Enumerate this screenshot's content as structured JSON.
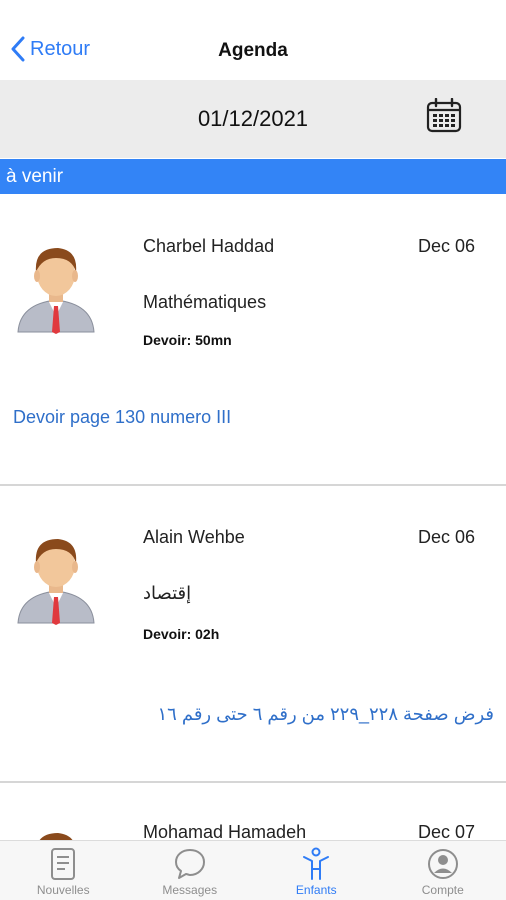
{
  "nav": {
    "back_label": "Retour",
    "title": "Agenda"
  },
  "date_picker": {
    "value": "01/12/2021"
  },
  "section": {
    "label": "à venir"
  },
  "items": [
    {
      "teacher": "Charbel Haddad",
      "date": "Dec 06",
      "subject": "Mathématiques",
      "duration": "Devoir: 50mn",
      "description": "Devoir page 130 numero III"
    },
    {
      "teacher": "Alain Wehbe",
      "date": "Dec 06",
      "subject": "إقتصاد",
      "duration": "Devoir: 02h",
      "description": "فرض صفحة ٢٢٨_٢٢٩ من رقم ٦ حتى رقم ١٦"
    },
    {
      "teacher": "Mohamad Hamadeh",
      "date": "Dec 07"
    }
  ],
  "tabs": [
    {
      "label": "Nouvelles",
      "icon": "news-icon"
    },
    {
      "label": "Messages",
      "icon": "messages-icon"
    },
    {
      "label": "Enfants",
      "icon": "children-icon"
    },
    {
      "label": "Compte",
      "icon": "account-icon"
    }
  ],
  "colors": {
    "accent": "#2f7cf6",
    "section_bar": "#3384f6",
    "date_bar": "#ececec",
    "link_text": "#2f6fc9",
    "tab_inactive": "#8e8e8e"
  }
}
